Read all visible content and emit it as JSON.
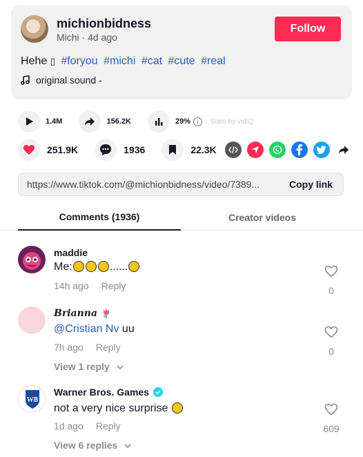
{
  "post": {
    "username": "michionbidness",
    "display_name": "Michi",
    "posted": "4d ago",
    "follow_label": "Follow",
    "caption_text": "Hehe",
    "caption_glyph": "▯",
    "hashtags": [
      "#foryou",
      "#michi",
      "#cat",
      "#cute",
      "#real"
    ],
    "sound": "original sound -"
  },
  "stats": {
    "plays": "1.4M",
    "shares_fwd": "156.2K",
    "engagement": "29%",
    "vidiq_label": "Stats by vidIQ",
    "likes": "251.9K",
    "comments": "1936",
    "saves": "22.3K"
  },
  "link": {
    "url": "https://www.tiktok.com/@michionbidness/video/7389...",
    "copy_label": "Copy link"
  },
  "tabs": {
    "comments": "Comments (1936)",
    "creator": "Creator videos"
  },
  "comments": [
    {
      "name": "maddie",
      "text": "Me:",
      "text_suffix": "......",
      "time": "14h ago",
      "reply": "Reply",
      "likes": "0"
    },
    {
      "name": "𝑩𝒓𝒊𝒂𝒏𝒏𝒂",
      "mention": "@Cristian Nv",
      "text": " uu",
      "time": "7h ago",
      "reply": "Reply",
      "likes": "0",
      "view_replies": "View 1 reply"
    },
    {
      "name": "Warner Bros. Games",
      "text": "not a very nice surprise",
      "time": "1d ago",
      "reply": "Reply",
      "likes": "609",
      "view_replies": "View 6 replies"
    }
  ],
  "colors": {
    "accent": "#fe2c55",
    "link": "#2b5db9",
    "muted": "#8a8b91"
  }
}
